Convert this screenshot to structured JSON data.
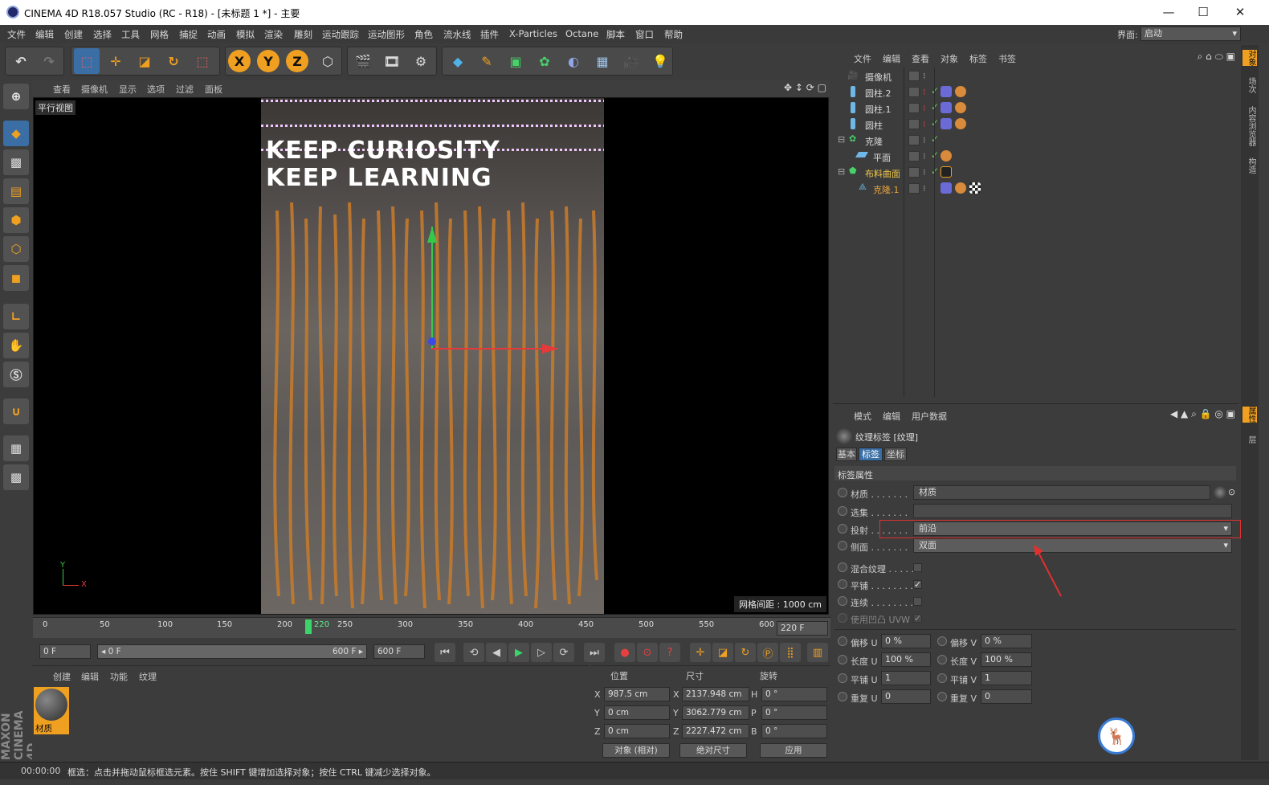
{
  "window": {
    "title": "CINEMA 4D R18.057 Studio (RC - R18) - [未标题 1 *] - 主要",
    "minimize": "—",
    "maximize": "☐",
    "close": "✕"
  },
  "menu": {
    "items": [
      "文件",
      "编辑",
      "创建",
      "选择",
      "工具",
      "网格",
      "捕捉",
      "动画",
      "模拟",
      "渲染",
      "雕刻",
      "运动跟踪",
      "运动图形",
      "角色",
      "流水线",
      "插件",
      "X-Particles",
      "Octane",
      "脚本",
      "窗口",
      "帮助"
    ],
    "layout_label": "界面:",
    "layout_value": "启动"
  },
  "toolbar": {
    "x_label": "X",
    "y_label": "Y",
    "z_label": "Z"
  },
  "viewport": {
    "menu": [
      "查看",
      "摄像机",
      "显示",
      "选项",
      "过滤",
      "面板"
    ],
    "label": "平行视图",
    "poster_line1": "KEEP CURIOSITY",
    "poster_line2": "KEEP LEARNING",
    "grid_distance": "网格间距 : 1000 cm",
    "axis_y": "Y",
    "axis_x": "X"
  },
  "timeline": {
    "ticks": [
      "0",
      "50",
      "100",
      "150",
      "200",
      "220",
      "250",
      "300",
      "350",
      "400",
      "450",
      "500",
      "550",
      "600"
    ],
    "current_frame": "220",
    "end_field": "220 F"
  },
  "playbar": {
    "start_field": "0 F",
    "range_start": "◂ 0 F",
    "range_end": "600 F ▸",
    "end_field": "600 F"
  },
  "material_manager": {
    "menu": [
      "创建",
      "编辑",
      "功能",
      "纹理"
    ],
    "material_name": "材质"
  },
  "coordinates": {
    "headers": [
      "位置",
      "尺寸",
      "旋转"
    ],
    "rows": [
      {
        "axis": "X",
        "pos": "987.5 cm",
        "size_axis": "X",
        "size": "2137.948 cm",
        "rot_axis": "H",
        "rot": "0 °"
      },
      {
        "axis": "Y",
        "pos": "0 cm",
        "size_axis": "Y",
        "size": "3062.779 cm",
        "rot_axis": "P",
        "rot": "0 °"
      },
      {
        "axis": "Z",
        "pos": "0 cm",
        "size_axis": "Z",
        "size": "2227.472 cm",
        "rot_axis": "B",
        "rot": "0 °"
      }
    ],
    "mode_select": "对象 (相对)",
    "size_select": "绝对尺寸",
    "apply": "应用"
  },
  "status": {
    "time": "00:00:00",
    "message": "框选：点击并拖动鼠标框选元素。按住 SHIFT 键增加选择对象；按住 CTRL 键减少选择对象。"
  },
  "object_manager": {
    "menu": [
      "文件",
      "编辑",
      "查看",
      "对象",
      "标签",
      "书签"
    ],
    "objects": [
      {
        "name": "摄像机",
        "icon": "camera-icon",
        "color": "#d8d8d8"
      },
      {
        "name": "圆柱.2",
        "icon": "cylinder-icon",
        "color": "#d8d8d8"
      },
      {
        "name": "圆柱.1",
        "icon": "cylinder-icon",
        "color": "#d8d8d8"
      },
      {
        "name": "圆柱",
        "icon": "cylinder-icon",
        "color": "#d8d8d8"
      },
      {
        "name": "克隆",
        "icon": "cloner-icon",
        "color": "#d8d8d8"
      },
      {
        "name": "平面",
        "icon": "plane-icon",
        "color": "#d8d8d8"
      },
      {
        "name": "布料曲面",
        "icon": "cloth-surface-icon",
        "color": "#f2c84b"
      },
      {
        "name": "克隆.1",
        "icon": "cloner-icon",
        "color": "#e9a23b"
      }
    ]
  },
  "attribute_manager": {
    "menu": [
      "模式",
      "编辑",
      "用户数据"
    ],
    "header": "纹理标签 [纹理]",
    "tabs": [
      "基本",
      "标签",
      "坐标"
    ],
    "section": "标签属性",
    "fields": {
      "material_label": "材质 . . . . . . .",
      "material_value": "材质",
      "selection_label": "选集 . . . . . . .",
      "selection_value": "",
      "projection_label": "投射 . . . . . . .",
      "projection_value": "前沿",
      "side_label": "侧面 . . . . . . .",
      "side_value": "双面",
      "mix_label": "混合纹理 . . . . .",
      "tile_label": "平铺 . . . . . . . .",
      "seamless_label": "连续 . . . . . . . .",
      "uvw_label": "使用凹凸 UVW"
    },
    "offset_u_label": "偏移 U",
    "offset_u": "0 %",
    "offset_v_label": "偏移 V",
    "offset_v": "0 %",
    "length_u_label": "长度 U",
    "length_u": "100 %",
    "length_v_label": "长度 V",
    "length_v": "100 %",
    "tiles_u_label": "平铺 U",
    "tiles_u": "1",
    "tiles_v_label": "平铺 V",
    "tiles_v": "1",
    "repeat_u_label": "重复 U",
    "repeat_u": "0",
    "repeat_v_label": "重复 V",
    "repeat_v": "0"
  },
  "right_tabs": [
    "对象",
    "场次",
    "内容浏览器",
    "构造",
    "属性",
    "层"
  ],
  "colors": {
    "accent_orange": "#f0a020",
    "highlight_blue": "#3a6ea5",
    "annotation_red": "#e03030"
  }
}
